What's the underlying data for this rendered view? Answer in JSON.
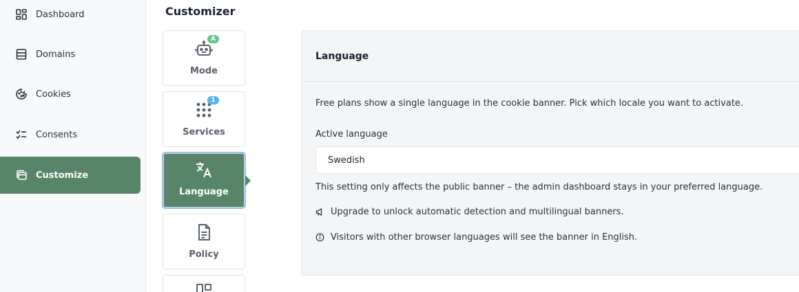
{
  "sidebar": {
    "items": [
      {
        "label": "Dashboard",
        "icon": "dashboard-icon"
      },
      {
        "label": "Domains",
        "icon": "domains-icon"
      },
      {
        "label": "Cookies",
        "icon": "cookie-icon"
      },
      {
        "label": "Consents",
        "icon": "checklist-icon"
      },
      {
        "label": "Customize",
        "icon": "customize-icon",
        "active": true
      }
    ]
  },
  "customizer": {
    "title": "Customizer",
    "tiles": [
      {
        "label": "Mode",
        "icon": "robot-icon",
        "badge": "A"
      },
      {
        "label": "Services",
        "icon": "grid-dots-icon",
        "badge": "1"
      },
      {
        "label": "Language",
        "icon": "translate-icon",
        "active": true
      },
      {
        "label": "Policy",
        "icon": "document-icon"
      },
      {
        "label": "",
        "icon": "layout-icon"
      }
    ]
  },
  "panel": {
    "title": "Language",
    "description": "Free plans show a single language in the cookie banner. Pick which locale you want to activate.",
    "field_label": "Active language",
    "selected_language": "Swedish",
    "note": "This setting only affects the public banner – the admin dashboard stays in your preferred language.",
    "upgrade_text": "Upgrade to unlock automatic detection and multilingual banners.",
    "info_text": "Visitors with other browser languages will see the banner in English."
  },
  "colors": {
    "accent": "#588567",
    "badge_green": "#5dc98a",
    "badge_blue": "#56b3ee"
  }
}
